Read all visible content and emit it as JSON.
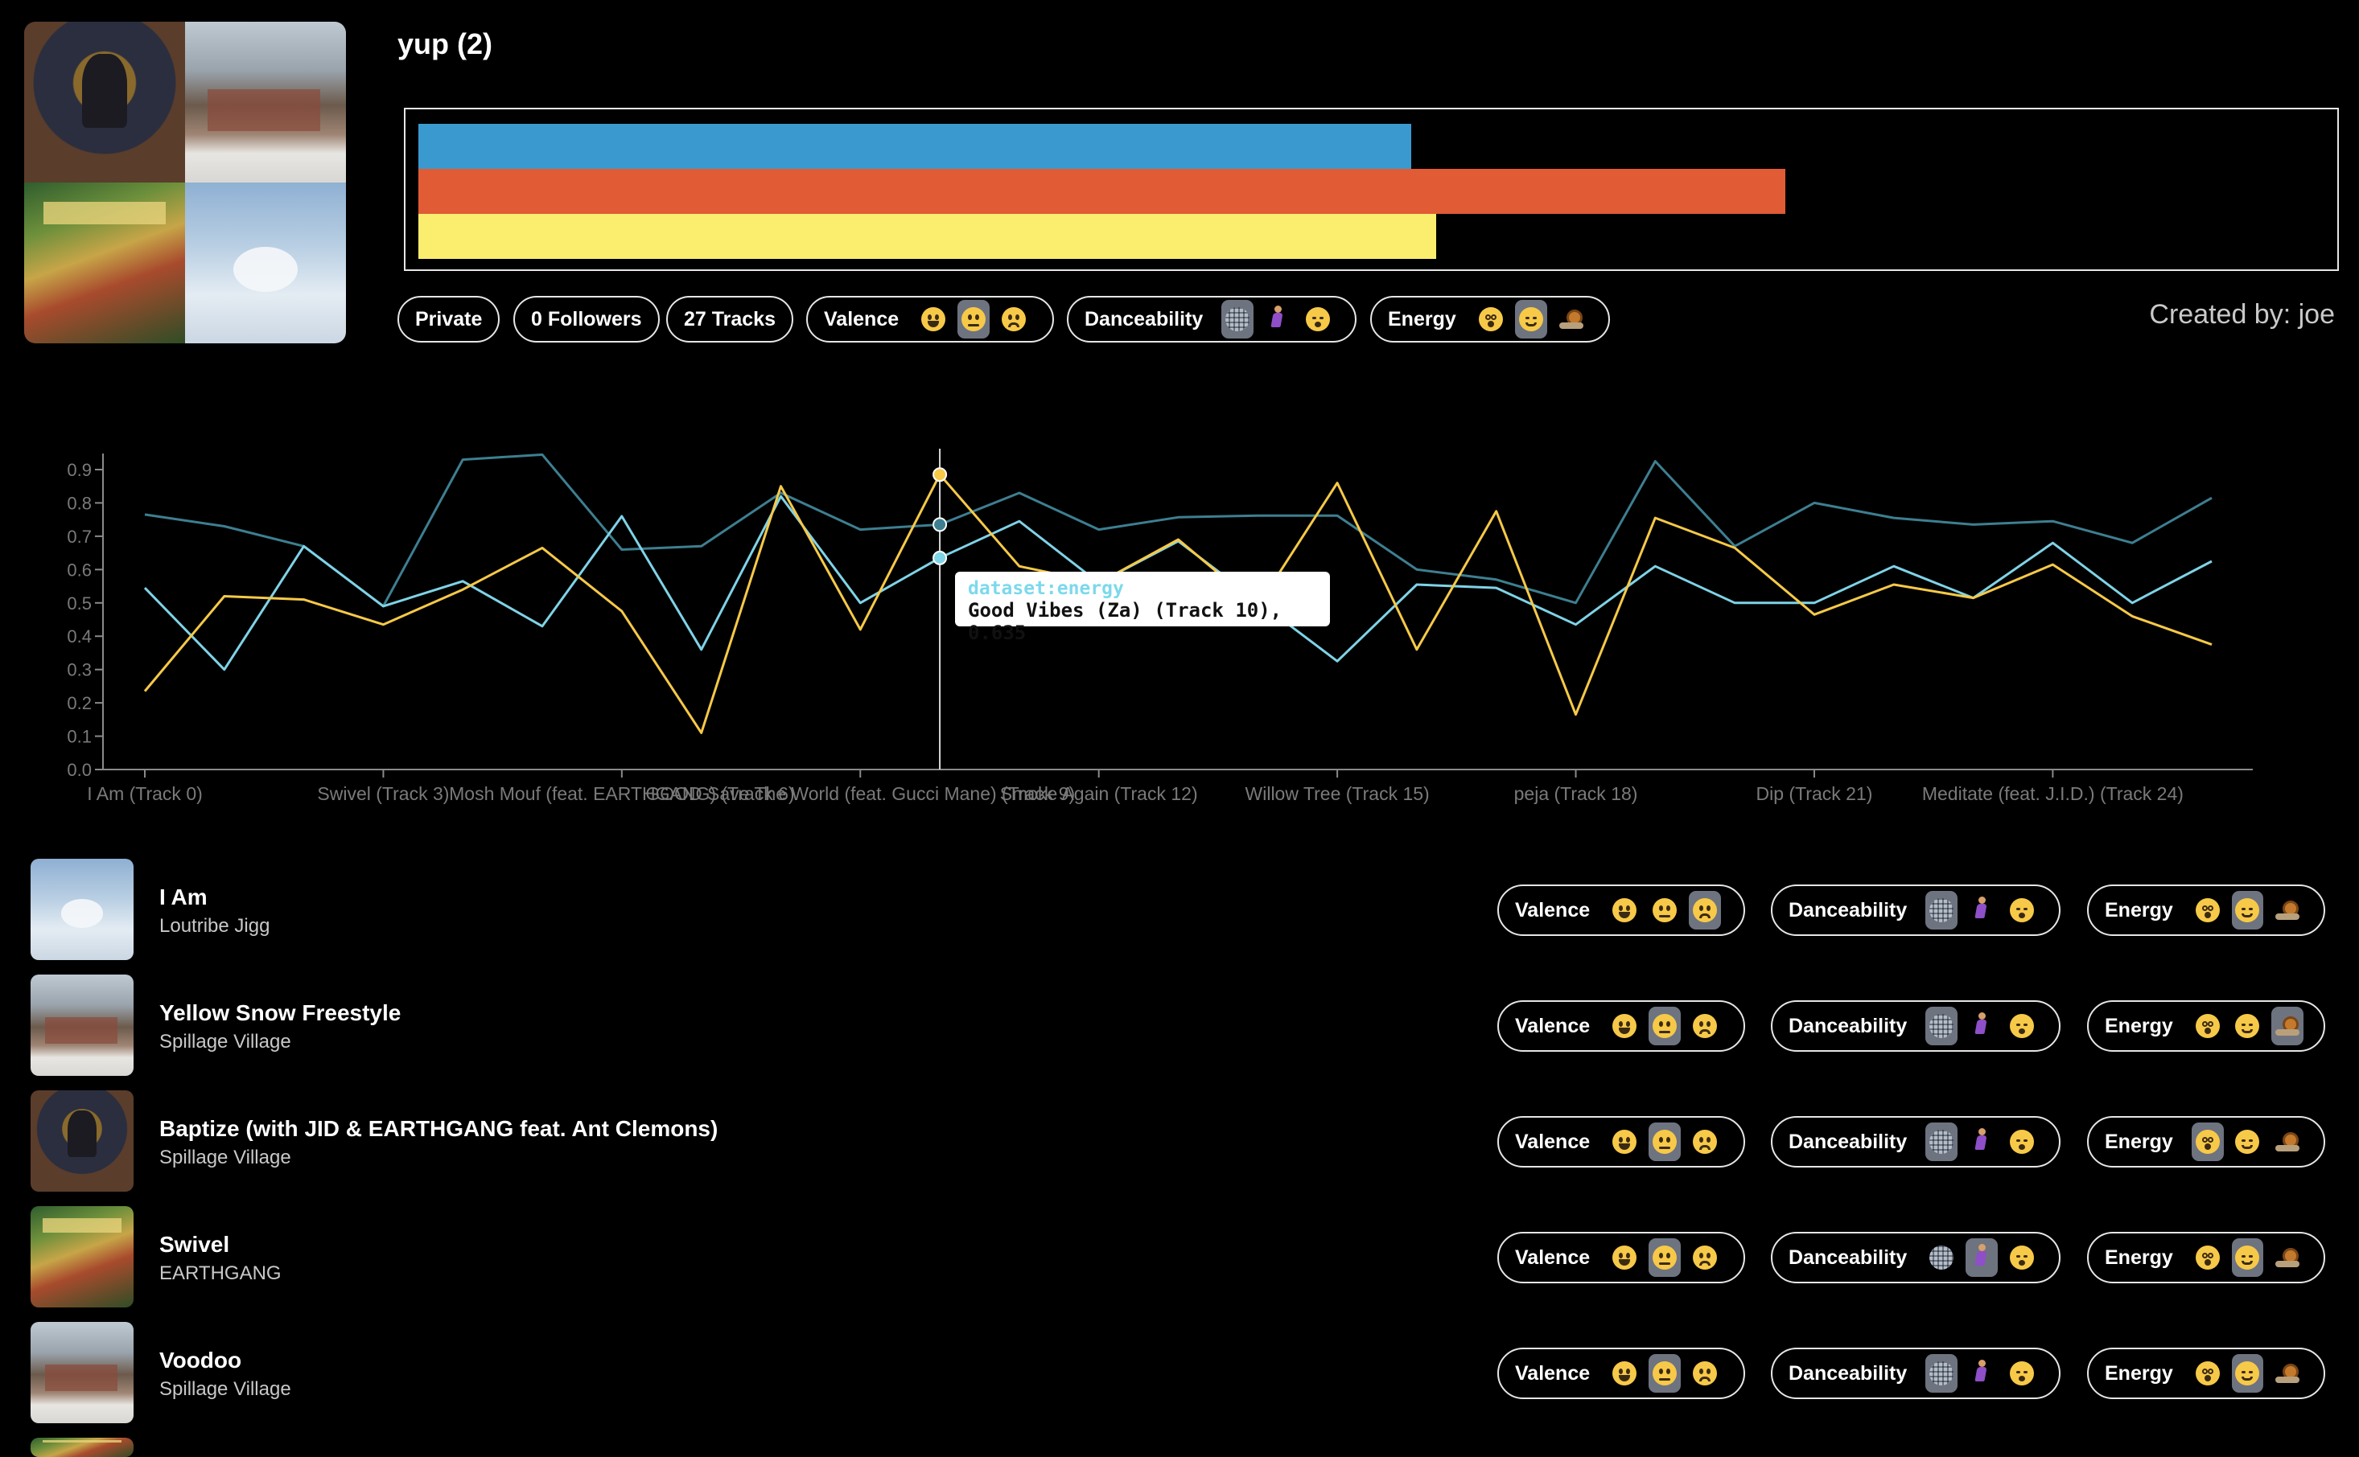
{
  "playlist": {
    "title": "yup (2)",
    "created_by": "Created by: joe",
    "feature_bars": [
      {
        "feature": "valence",
        "value": 0.52,
        "color": "#3a9ad0"
      },
      {
        "feature": "danceability",
        "value": 0.716,
        "color": "#e15b35"
      },
      {
        "feature": "energy",
        "value": 0.533,
        "color": "#fbee6f"
      }
    ],
    "stats": {
      "privacy": "Private",
      "followers": "0 Followers",
      "tracks": "27 Tracks"
    },
    "mood_summary": {
      "valence": {
        "label": "Valence",
        "options": [
          "grin-face-icon",
          "neutral-face-icon",
          "sad-face-icon"
        ],
        "selected": 1
      },
      "danceability": {
        "label": "Danceability",
        "options": [
          "disco-ball-icon",
          "dancer-icon",
          "sleeping-face-icon"
        ],
        "selected": 0
      },
      "energy": {
        "label": "Energy",
        "options": [
          "dizzy-face-icon",
          "relieved-face-icon",
          "snail-icon"
        ],
        "selected": 1
      }
    }
  },
  "chart_data": {
    "type": "line",
    "title": "",
    "ylim": [
      0,
      0.95
    ],
    "yticks": [
      "0.0",
      "0.1",
      "0.2",
      "0.3",
      "0.4",
      "0.5",
      "0.6",
      "0.7",
      "0.8",
      "0.9"
    ],
    "x_tick_labels": [
      {
        "index": 0,
        "label": "I Am (Track 0)"
      },
      {
        "index": 3,
        "label": "Swivel (Track 3)"
      },
      {
        "index": 6,
        "label": "Mosh Mouf (feat. EARTHGANG) (Track 6)"
      },
      {
        "index": 9,
        "label": "GOOD Save The World (feat. Gucci Mane) (Track 9)"
      },
      {
        "index": 12,
        "label": "Smoke Again (Track 12)"
      },
      {
        "index": 15,
        "label": "Willow Tree (Track 15)"
      },
      {
        "index": 18,
        "label": "peja (Track 18)"
      },
      {
        "index": 21,
        "label": "Dip (Track 21)"
      },
      {
        "index": 24,
        "label": "Meditate (feat. J.I.D.) (Track 24)"
      }
    ],
    "series": [
      {
        "id": "danceability",
        "color": "#3d7f91",
        "values": [
          0.765,
          0.73,
          0.67,
          0.49,
          0.93,
          0.945,
          0.66,
          0.67,
          0.83,
          0.72,
          0.735,
          0.83,
          0.72,
          0.757,
          0.762,
          0.762,
          0.6,
          0.57,
          0.5,
          0.925,
          0.67,
          0.8,
          0.755,
          0.735,
          0.745,
          0.68,
          0.815
        ]
      },
      {
        "id": "energy",
        "color": "#7fd3e7",
        "values": [
          0.545,
          0.3,
          0.67,
          0.49,
          0.565,
          0.43,
          0.76,
          0.36,
          0.82,
          0.5,
          0.635,
          0.745,
          0.56,
          0.685,
          0.505,
          0.325,
          0.555,
          0.545,
          0.435,
          0.61,
          0.5,
          0.5,
          0.61,
          0.515,
          0.68,
          0.5,
          0.625
        ]
      },
      {
        "id": "valence",
        "color": "#f6c947",
        "values": [
          0.235,
          0.52,
          0.51,
          0.435,
          0.54,
          0.665,
          0.475,
          0.11,
          0.85,
          0.42,
          0.885,
          0.61,
          0.56,
          0.69,
          0.49,
          0.86,
          0.36,
          0.775,
          0.165,
          0.755,
          0.665,
          0.465,
          0.555,
          0.515,
          0.615,
          0.46,
          0.375
        ]
      }
    ],
    "hover_index": 10,
    "tooltip": {
      "title": "dataset:energy",
      "body": "Good Vibes (Za) (Track 10), 0.635"
    }
  },
  "tracks": [
    {
      "name": "I Am",
      "artist": "Loutribe Jigg",
      "art": "art-d",
      "valence": {
        "label": "Valence",
        "selected": 2
      },
      "danceability": {
        "label": "Danceability",
        "selected": 0
      },
      "energy": {
        "label": "Energy",
        "selected": 1
      }
    },
    {
      "name": "Yellow Snow Freestyle",
      "artist": "Spillage Village",
      "art": "art-b",
      "valence": {
        "label": "Valence",
        "selected": 1
      },
      "danceability": {
        "label": "Danceability",
        "selected": 0
      },
      "energy": {
        "label": "Energy",
        "selected": 2
      }
    },
    {
      "name": "Baptize (with JID & EARTHGANG feat. Ant Clemons)",
      "artist": "Spillage Village",
      "art": "art-a",
      "valence": {
        "label": "Valence",
        "selected": 1
      },
      "danceability": {
        "label": "Danceability",
        "selected": 0
      },
      "energy": {
        "label": "Energy",
        "selected": 0
      }
    },
    {
      "name": "Swivel",
      "artist": "EARTHGANG",
      "art": "art-c",
      "valence": {
        "label": "Valence",
        "selected": 1
      },
      "danceability": {
        "label": "Danceability",
        "selected": 1
      },
      "energy": {
        "label": "Energy",
        "selected": 1
      }
    },
    {
      "name": "Voodoo",
      "artist": "Spillage Village",
      "art": "art-b",
      "valence": {
        "label": "Valence",
        "selected": 1
      },
      "danceability": {
        "label": "Danceability",
        "selected": 0
      },
      "energy": {
        "label": "Energy",
        "selected": 1
      }
    }
  ]
}
